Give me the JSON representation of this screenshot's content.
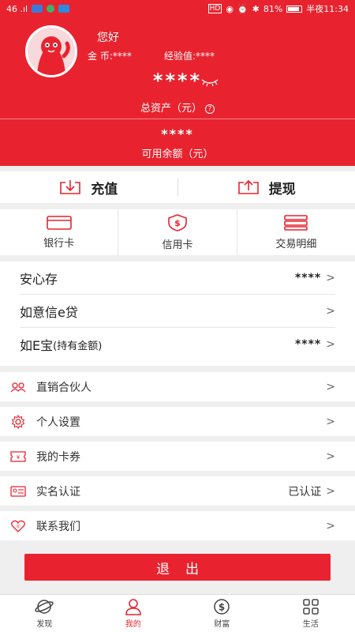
{
  "status_bar": {
    "left_text": "46 .ıl",
    "right_text": "81%",
    "time": "半夜11:34"
  },
  "profile": {
    "greeting": "您好",
    "coins_label": "金  币:****",
    "exp_label": "经验值:****"
  },
  "assets": {
    "total_value": "****",
    "total_label": "总资产（元）",
    "help_icon": "?",
    "balance_value": "****",
    "balance_label": "可用余额（元）"
  },
  "actions": {
    "recharge": "充值",
    "withdraw": "提现"
  },
  "cards": {
    "bank_card": "银行卡",
    "credit_card": "信用卡",
    "transactions": "交易明细"
  },
  "wealth": [
    {
      "label": "安心存",
      "value": "****"
    },
    {
      "label": "如意信e贷",
      "value": ""
    },
    {
      "label": "如E宝",
      "note": "(持有金额)",
      "value": "****"
    }
  ],
  "menu": [
    {
      "label": "直销合伙人",
      "right": ""
    },
    {
      "label": "个人设置",
      "right": ""
    },
    {
      "label": "我的卡券",
      "right": ""
    },
    {
      "label": "实名认证",
      "right": "已认证"
    },
    {
      "label": "联系我们",
      "right": ""
    }
  ],
  "chevron": ">",
  "logout_label": "退出",
  "tabs": [
    {
      "label": "发现",
      "icon": "planet-icon"
    },
    {
      "label": "我的",
      "icon": "user-icon"
    },
    {
      "label": "财富",
      "icon": "dollar-icon"
    },
    {
      "label": "生活",
      "icon": "grid-icon"
    }
  ],
  "colors": {
    "brand_red": "#e8232f",
    "background": "#efefef"
  }
}
